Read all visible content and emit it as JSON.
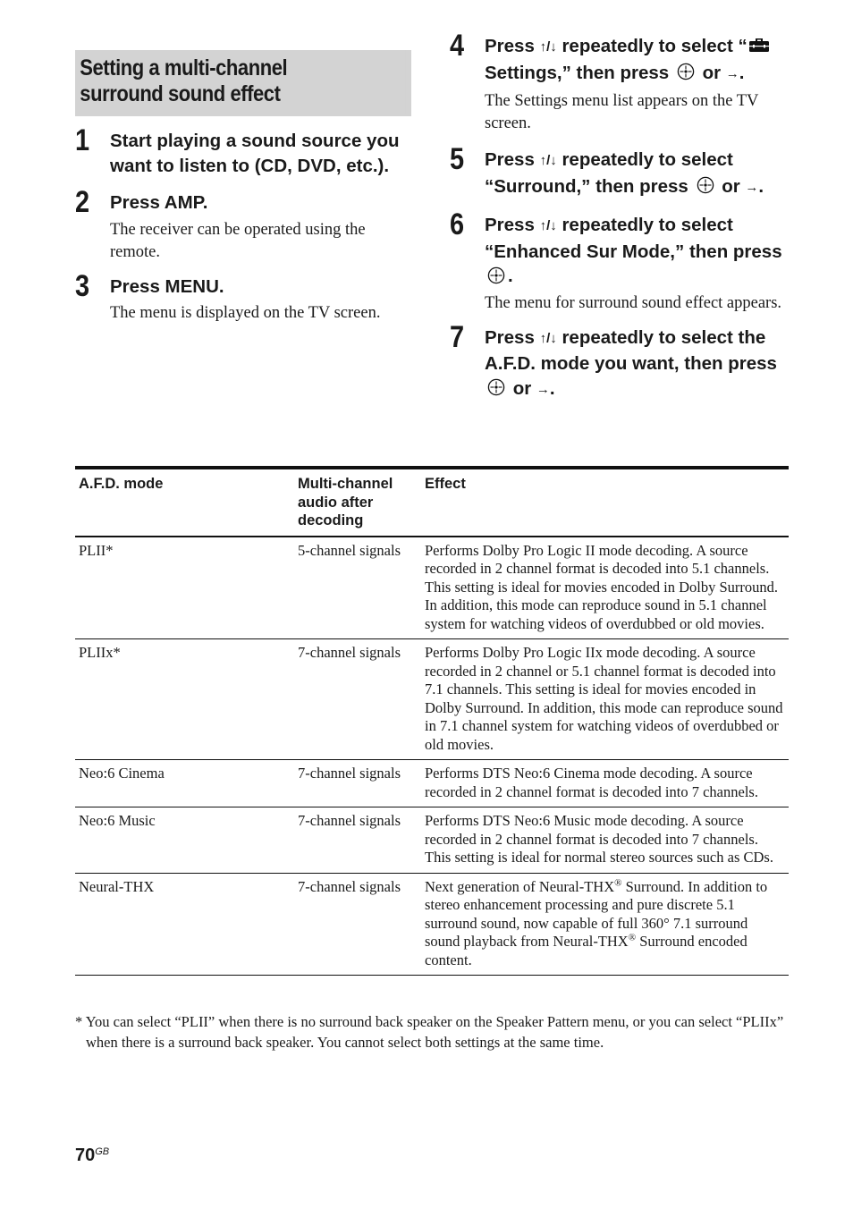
{
  "section": {
    "title_line1": "Setting a multi-channel",
    "title_line2": "surround sound effect"
  },
  "icons": {
    "up_down": "↑/↓",
    "right": "→",
    "enter": "enter-button",
    "settings": "toolbox"
  },
  "steps": [
    {
      "num": "1",
      "head": "Start playing a sound source you want to listen to (CD, DVD, etc.).",
      "desc": ""
    },
    {
      "num": "2",
      "head": "Press AMP.",
      "desc": "The receiver can be operated using the remote."
    },
    {
      "num": "3",
      "head": "Press MENU.",
      "desc": "The menu is displayed on the TV screen."
    },
    {
      "num": "4",
      "head_a": "Press",
      "head_b": "repeatedly to select “",
      "head_c": "Settings,” then press",
      "head_d": "or",
      "head_e": ".",
      "desc": "The Settings menu list appears on the TV screen."
    },
    {
      "num": "5",
      "head_a": "Press",
      "head_b": "repeatedly to select “Surround,” then press",
      "head_c": "or",
      "head_d": ".",
      "desc": ""
    },
    {
      "num": "6",
      "head_a": "Press",
      "head_b": "repeatedly to select “Enhanced Sur Mode,” then press",
      "head_c": ".",
      "desc": "The menu for surround sound effect appears."
    },
    {
      "num": "7",
      "head_a": "Press",
      "head_b": "repeatedly to select the A.F.D. mode you want, then press",
      "head_c": "or",
      "head_d": ".",
      "desc": ""
    }
  ],
  "table": {
    "headers": [
      "A.F.D. mode",
      "Multi-channel audio after decoding",
      "Effect"
    ],
    "rows": [
      {
        "mode": "PLII*",
        "channels": "5-channel signals",
        "effect": "Performs Dolby Pro Logic II mode decoding. A source recorded in 2 channel format is decoded into 5.1 channels. This setting is ideal for movies encoded in Dolby Surround. In addition, this mode can reproduce sound in 5.1 channel system for watching videos of overdubbed or old movies."
      },
      {
        "mode": "PLIIx*",
        "channels": "7-channel signals",
        "effect": "Performs Dolby Pro Logic IIx mode decoding. A source recorded in 2 channel or 5.1 channel format is decoded into 7.1 channels. This setting is ideal for movies encoded in Dolby Surround. In addition, this mode can reproduce sound in 7.1 channel system for watching videos of overdubbed or old movies."
      },
      {
        "mode": "Neo:6 Cinema",
        "channels": "7-channel signals",
        "effect": "Performs DTS Neo:6 Cinema mode decoding. A source recorded in 2 channel format is decoded into 7 channels."
      },
      {
        "mode": "Neo:6 Music",
        "channels": "7-channel signals",
        "effect": "Performs DTS Neo:6 Music mode decoding. A source recorded in 2 channel format is decoded into 7 channels. This setting is ideal for normal stereo sources such as CDs."
      },
      {
        "mode": "Neural-THX",
        "channels": "7-channel signals",
        "effect_a": "Next generation of Neural-THX",
        "effect_reg": "®",
        "effect_b": " Surround. In addition to stereo enhancement processing and pure discrete 5.1 surround sound, now capable of full 360° 7.1 surround sound playback from Neural-THX",
        "effect_c": " Surround encoded content."
      }
    ]
  },
  "footnote": "* You can select “PLII” when there is no surround back speaker on the Speaker Pattern menu, or you can select “PLIIx” when there is a surround back speaker. You cannot select both settings at the same time.",
  "page": {
    "number": "70",
    "region": "GB"
  }
}
